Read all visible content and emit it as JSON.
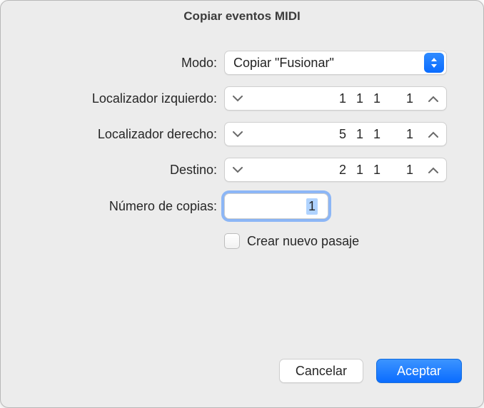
{
  "title": "Copiar eventos MIDI",
  "labels": {
    "mode": "Modo:",
    "leftLocator": "Localizador izquierdo:",
    "rightLocator": "Localizador derecho:",
    "destination": "Destino:",
    "numCopies": "Número de copias:",
    "createNewRegion": "Crear nuevo pasaje"
  },
  "values": {
    "mode": "Copiar \"Fusionar\"",
    "leftLocator": {
      "bar": "1",
      "beat": "1",
      "div": "1",
      "tick": "1"
    },
    "rightLocator": {
      "bar": "5",
      "beat": "1",
      "div": "1",
      "tick": "1"
    },
    "destination": {
      "bar": "2",
      "beat": "1",
      "div": "1",
      "tick": "1"
    },
    "numCopies": "1",
    "createNewRegion": false
  },
  "buttons": {
    "cancel": "Cancelar",
    "ok": "Aceptar"
  }
}
